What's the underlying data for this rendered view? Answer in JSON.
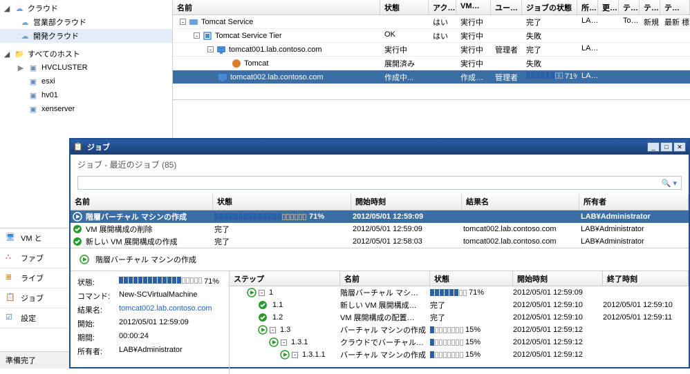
{
  "nav": {
    "cloud_root": "クラウド",
    "cloud_sales": "営業部クラウド",
    "cloud_dev": "開発クラウド",
    "hosts_root": "すべてのホスト",
    "hosts": [
      "HVCLUSTER",
      "esxi",
      "hv01",
      "xenserver"
    ]
  },
  "left_bottom": {
    "vm": "VM と",
    "fabric": "ファブ",
    "library": "ライブ",
    "jobs": "ジョブ",
    "settings": "設定"
  },
  "status_bar": "準備完了",
  "grid": {
    "headers": [
      "名前",
      "状態",
      "アク…",
      "VM…",
      "ユー…",
      "ジョブの状態",
      "所…",
      "更…",
      "テ…",
      "テ…",
      "テ…"
    ],
    "rows": [
      {
        "indent": 0,
        "toggle": "-",
        "icon": "service",
        "name": "Tomcat Service",
        "state": "",
        "act": "はい",
        "vm": "実行中",
        "user": "",
        "job": "完了",
        "c1": "LA…",
        "c2": "",
        "c3": "To…",
        "c4": "新規",
        "c5": "最新  標"
      },
      {
        "indent": 1,
        "toggle": "-",
        "icon": "tier",
        "name": "Tomcat Service Tier",
        "state": "OK",
        "act": "はい",
        "vm": "実行中",
        "user": "",
        "job": "失敗",
        "c1": "",
        "c2": "",
        "c3": "",
        "c4": "",
        "c5": ""
      },
      {
        "indent": 2,
        "toggle": "-",
        "icon": "vm",
        "name": "tomcat001.lab.contoso.com",
        "state": "実行中",
        "act": "",
        "vm": "実行中",
        "user": "管理者",
        "job": "完了",
        "c1": "LA…",
        "c2": "",
        "c3": "",
        "c4": "",
        "c5": ""
      },
      {
        "indent": 3,
        "toggle": "",
        "icon": "tomcat",
        "name": "Tomcat",
        "state": "展開済み",
        "act": "",
        "vm": "実行中",
        "user": "",
        "job": "失敗",
        "c1": "",
        "c2": "",
        "c3": "",
        "c4": "",
        "c5": ""
      },
      {
        "indent": 2,
        "toggle": "",
        "icon": "vm",
        "name": "tomcat002.lab.contoso.com",
        "state": "作成中...",
        "act": "",
        "vm": "作成…",
        "user": "管理者",
        "job": "71%",
        "c1": "LA…",
        "c2": "",
        "c3": "",
        "c4": "",
        "c5": "",
        "selected": true,
        "progress": 71
      }
    ]
  },
  "jobs_window": {
    "title": "ジョブ",
    "subtitle": "ジョブ - 最近のジョブ (85)",
    "headers": [
      "名前",
      "状態",
      "開始時刻",
      "結果名",
      "所有者"
    ],
    "rows": [
      {
        "icon": "play",
        "name": "階層バーチャル マシンの作成",
        "state_pct": 71,
        "state_text": "71%",
        "start": "2012/05/01 12:59:09",
        "result": "",
        "owner": "LAB¥Administrator",
        "selected": true
      },
      {
        "icon": "ok",
        "name": "VM 展開構成の削除",
        "state_text": "完了",
        "start": "2012/05/01 12:59:09",
        "result": "tomcat002.lab.contoso.com",
        "owner": "LAB¥Administrator"
      },
      {
        "icon": "ok",
        "name": "新しい VM 展開構成の作成",
        "state_text": "完了",
        "start": "2012/05/01 12:58:03",
        "result": "tomcat002.lab.contoso.com",
        "owner": "LAB¥Administrator"
      }
    ],
    "detail_title": "階層バーチャル マシンの作成",
    "detail": {
      "state_label": "状態:",
      "state_pct": 71,
      "state_text": "71%",
      "command_label": "コマンド:",
      "command": "New-SCVirtualMachine",
      "result_label": "結果名:",
      "result": "tomcat002.lab.contoso.com",
      "start_label": "開始:",
      "start": "2012/05/01 12:59:09",
      "duration_label": "期間:",
      "duration": "00:00:24",
      "owner_label": "所有者:",
      "owner": "LAB¥Administrator"
    },
    "step_headers": [
      "ステップ",
      "名前",
      "状態",
      "開始時刻",
      "終了時刻"
    ],
    "steps": [
      {
        "indent": 0,
        "toggle": "-",
        "icon": "play",
        "num": "1",
        "name": "階層バーチャル マシ…",
        "pct": 71,
        "pct_text": "71%",
        "start": "2012/05/01 12:59:09",
        "end": ""
      },
      {
        "indent": 1,
        "toggle": "",
        "icon": "ok",
        "num": "1.1",
        "name": "新しい VM 展開構成…",
        "state_text": "完了",
        "start": "2012/05/01 12:59:10",
        "end": "2012/05/01 12:59:10"
      },
      {
        "indent": 1,
        "toggle": "",
        "icon": "ok",
        "num": "1.2",
        "name": "VM 展開構成の配置…",
        "state_text": "完了",
        "start": "2012/05/01 12:59:10",
        "end": "2012/05/01 12:59:11"
      },
      {
        "indent": 1,
        "toggle": "-",
        "icon": "play",
        "num": "1.3",
        "name": "バーチャル マシンの作成",
        "pct": 15,
        "pct_text": "15%",
        "start": "2012/05/01 12:59:12",
        "end": ""
      },
      {
        "indent": 2,
        "toggle": "-",
        "icon": "play",
        "num": "1.3.1",
        "name": "クラウドでバーチャル…",
        "pct": 15,
        "pct_text": "15%",
        "start": "2012/05/01 12:59:12",
        "end": ""
      },
      {
        "indent": 3,
        "toggle": "-",
        "icon": "play",
        "num": "1.3.1.1",
        "name": "バーチャル マシンの作成",
        "pct": 15,
        "pct_text": "15%",
        "start": "2012/05/01 12:59:12",
        "end": ""
      }
    ]
  }
}
